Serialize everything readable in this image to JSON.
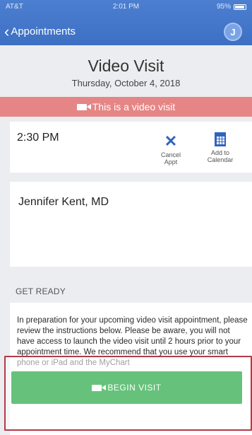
{
  "status": {
    "carrier": "AT&T",
    "time": "2:01 PM",
    "battery": "95%"
  },
  "nav": {
    "back_label": "Appointments",
    "avatar_initial": "J"
  },
  "header": {
    "title": "Video Visit",
    "date": "Thursday, October 4, 2018"
  },
  "banner": {
    "text": "This is a video visit"
  },
  "appointment": {
    "time": "2:30 PM",
    "cancel_label": [
      "Cancel",
      "Appt"
    ],
    "calendar_label": [
      "Add to",
      "Calendar"
    ]
  },
  "provider": {
    "name": "Jennifer Kent, MD"
  },
  "get_ready": {
    "heading": "GET READY",
    "text": "In preparation for your upcoming video visit appointment, please review the instructions below.  Please be aware, you will not have access to launch the video visit until 2 hours prior to your appointment time. We recommend that you use your smart phone or iPad and the MyChart"
  },
  "begin_button": {
    "label": "BEGIN VISIT"
  },
  "colors": {
    "nav": "#3d6fc3",
    "banner": "#e68585",
    "begin": "#66c27b",
    "icon": "#2f64c0"
  }
}
